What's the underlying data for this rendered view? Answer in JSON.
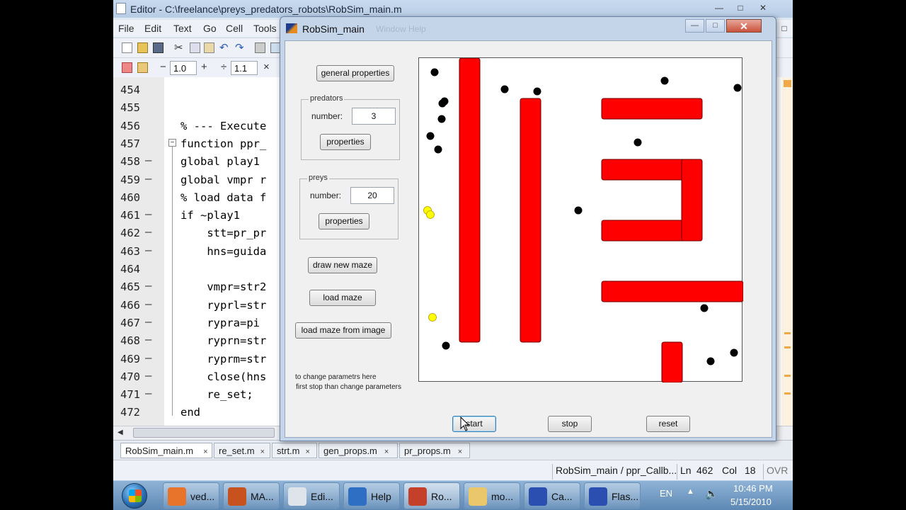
{
  "editor": {
    "title": "Editor - C:\\freelance\\preys_predators_robots\\RobSim_main.m",
    "menu": [
      "File",
      "Edit",
      "Text",
      "Go",
      "Cell",
      "Tools"
    ],
    "cell_value_1": "1.0",
    "cell_value_2": "1.1",
    "lines": [
      {
        "num": "454",
        "dash": "",
        "text": ""
      },
      {
        "num": "455",
        "dash": "",
        "text": ""
      },
      {
        "num": "456",
        "dash": "",
        "text": "% --- Execute"
      },
      {
        "num": "457",
        "dash": "",
        "text": "function ppr_"
      },
      {
        "num": "458",
        "dash": "—",
        "text": "global play1"
      },
      {
        "num": "459",
        "dash": "—",
        "text": "global vmpr r"
      },
      {
        "num": "460",
        "dash": "",
        "text": "% load data f"
      },
      {
        "num": "461",
        "dash": "—",
        "text": "if ~play1"
      },
      {
        "num": "462",
        "dash": "—",
        "text": "    stt=pr_pr"
      },
      {
        "num": "463",
        "dash": "—",
        "text": "    hns=guida"
      },
      {
        "num": "464",
        "dash": "",
        "text": ""
      },
      {
        "num": "465",
        "dash": "—",
        "text": "    vmpr=str2"
      },
      {
        "num": "466",
        "dash": "—",
        "text": "    ryprl=str"
      },
      {
        "num": "467",
        "dash": "—",
        "text": "    rypra=pi"
      },
      {
        "num": "468",
        "dash": "—",
        "text": "    ryprn=str"
      },
      {
        "num": "469",
        "dash": "—",
        "text": "    ryprm=str"
      },
      {
        "num": "470",
        "dash": "—",
        "text": "    close(hns"
      },
      {
        "num": "471",
        "dash": "—",
        "text": "    re_set;"
      },
      {
        "num": "472",
        "dash": "",
        "text": "end"
      }
    ],
    "tabs": [
      "RobSim_main.m",
      "re_set.m",
      "strt.m",
      "gen_props.m",
      "pr_props.m"
    ],
    "tab_close": "×",
    "status": {
      "function": "RobSim_main / ppr_Callb...",
      "ln_label": "Ln",
      "ln_value": "462",
      "col_label": "Col",
      "col_value": "18",
      "mode": "OVR"
    }
  },
  "dialog": {
    "title": "RobSim_main",
    "faded_menu": "Window   Help",
    "general_properties": "general properties",
    "predators": {
      "legend": "predators",
      "number_label": "number:",
      "number_value": "3",
      "properties": "properties"
    },
    "preys": {
      "legend": "preys",
      "number_label": "number:",
      "number_value": "20",
      "properties": "properties"
    },
    "draw_new_maze": "draw new maze",
    "load_maze": "load maze",
    "load_maze_from_image": "load maze from image",
    "note_line1": "to change parametrs here",
    "note_line2": "first stop than change parameters",
    "start": "start",
    "stop": "stop",
    "reset": "reset"
  },
  "taskbar": {
    "items": [
      "ved...",
      "MA...",
      "Edi...",
      "Help",
      "Ro...",
      "mo...",
      "Ca...",
      "Flas..."
    ],
    "lang": "EN",
    "time": "10:46 PM",
    "date": "5/15/2010"
  },
  "colors": {
    "wall": "#ff0000",
    "robot": "#000000",
    "prey": "#ffff00"
  }
}
